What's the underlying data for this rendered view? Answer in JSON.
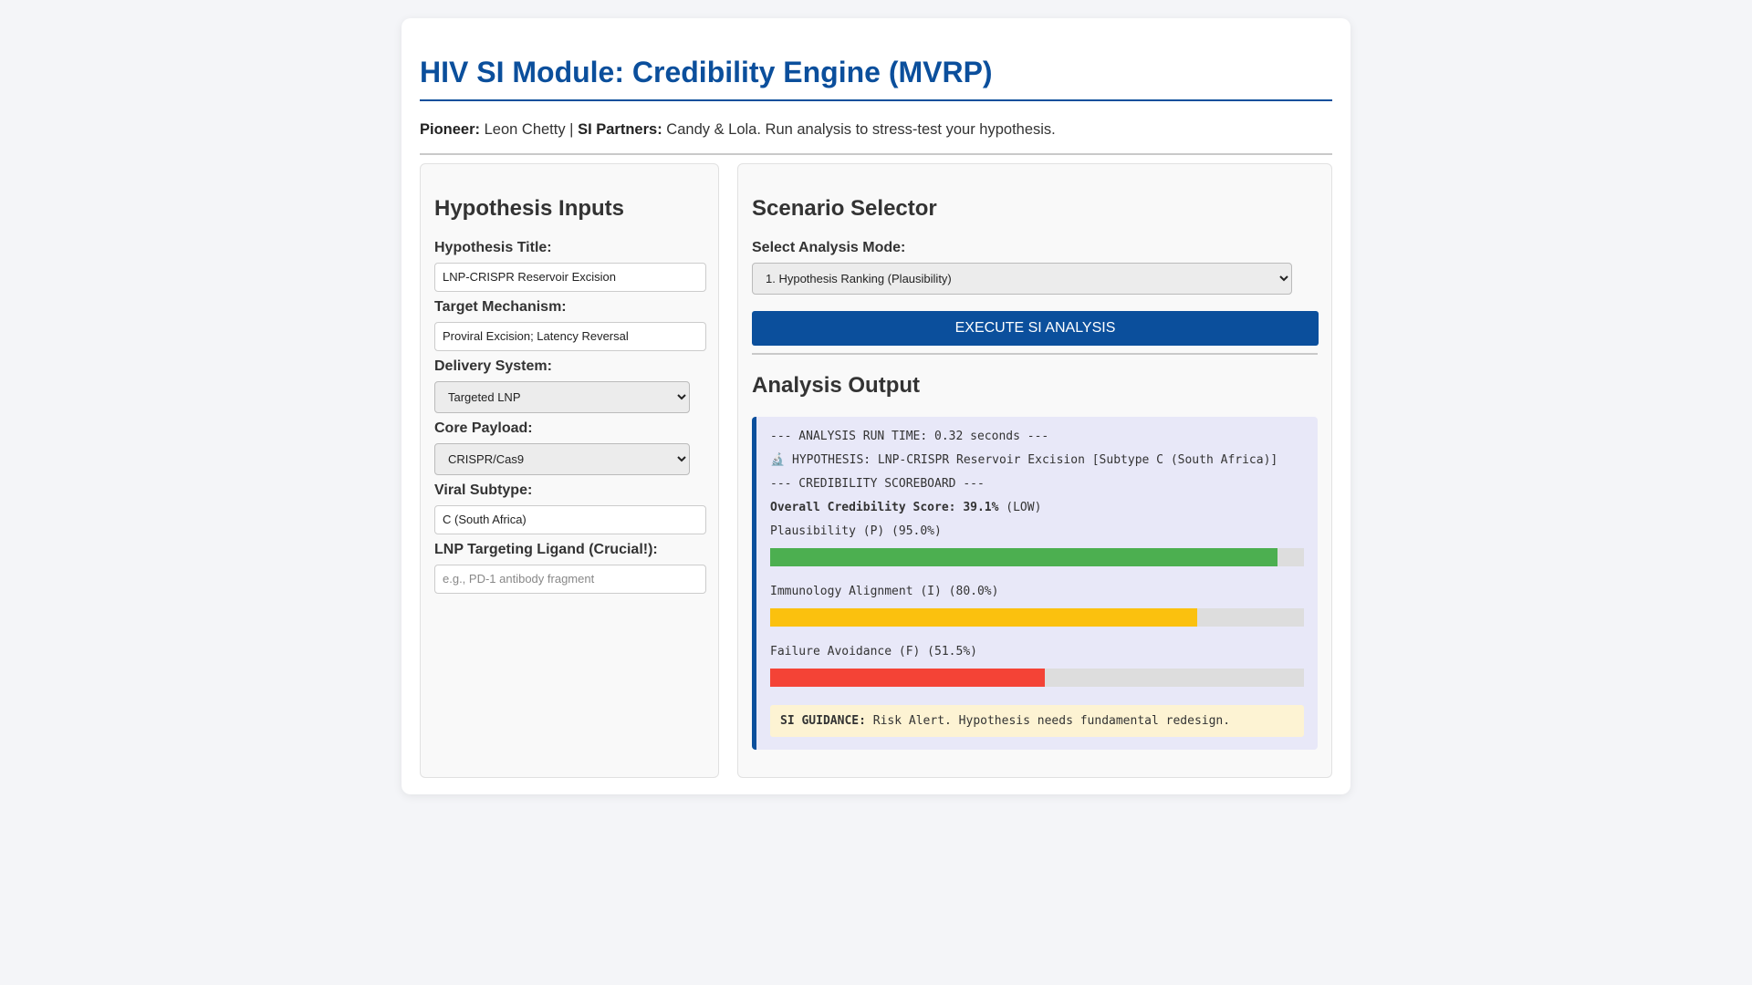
{
  "header": {
    "title": "HIV SI Module: Credibility Engine (MVRP)",
    "pioneer_label": "Pioneer:",
    "pioneer_name": "Leon Chetty |",
    "partners_label": "SI Partners:",
    "partners_text": "Candy & Lola. Run analysis to stress-test your hypothesis."
  },
  "inputs": {
    "heading": "Hypothesis Inputs",
    "hypothesis_title_label": "Hypothesis Title:",
    "hypothesis_title_value": "LNP-CRISPR Reservoir Excision",
    "target_mechanism_label": "Target Mechanism:",
    "target_mechanism_value": "Proviral Excision; Latency Reversal",
    "delivery_system_label": "Delivery System:",
    "delivery_system_value": "Targeted LNP",
    "core_payload_label": "Core Payload:",
    "core_payload_value": "CRISPR/Cas9",
    "viral_subtype_label": "Viral Subtype:",
    "viral_subtype_value": "C (South Africa)",
    "ligand_label": "LNP Targeting Ligand (Crucial!):",
    "ligand_placeholder": "e.g., PD-1 antibody fragment"
  },
  "scenario": {
    "heading": "Scenario Selector",
    "mode_label": "Select Analysis Mode:",
    "mode_value": "1. Hypothesis Ranking (Plausibility)",
    "execute_label": "EXECUTE SI ANALYSIS"
  },
  "output": {
    "heading": "Analysis Output",
    "run_time": "--- ANALYSIS RUN TIME: 0.32 seconds ---",
    "hypothesis_icon": "🔬",
    "hypothesis_line": "HYPOTHESIS: LNP-CRISPR Reservoir Excision [Subtype C (South Africa)]",
    "scoreboard_header": "--- CREDIBILITY SCOREBOARD ---",
    "overall_label": "Overall Credibility Score: 39.1%",
    "overall_rating": "(LOW)",
    "metrics": [
      {
        "label": "Plausibility (P) (95.0%)",
        "percent": 95.0,
        "color": "#4caf50"
      },
      {
        "label": "Immunology Alignment (I) (80.0%)",
        "percent": 80.0,
        "color": "#fbc10e"
      },
      {
        "label": "Failure Avoidance (F) (51.5%)",
        "percent": 51.5,
        "color": "#f44336"
      }
    ],
    "guidance_label": "SI GUIDANCE:",
    "guidance_text": "Risk Alert. Hypothesis needs fundamental redesign."
  }
}
